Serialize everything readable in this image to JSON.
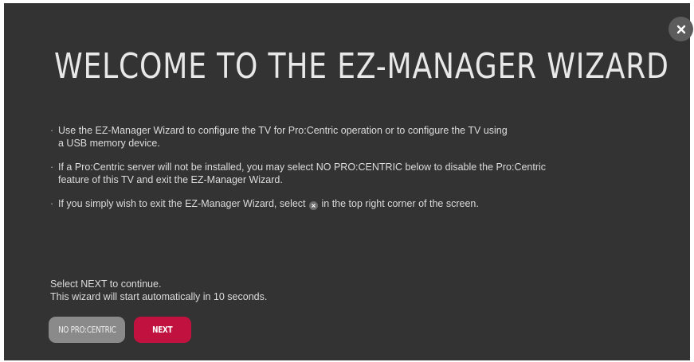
{
  "wizard": {
    "title": "WELCOME TO THE EZ-MANAGER WIZARD",
    "bullets": [
      {
        "line1": "Use the EZ-Manager Wizard to configure the TV for Pro:Centric operation or to configure the TV using",
        "line2": "a USB memory device."
      },
      {
        "line1": "If a Pro:Centric server will not be installed, you may select NO PRO:CENTRIC below to disable the Pro:Centric",
        "line2": "feature of this TV and exit the EZ-Manager Wizard."
      },
      {
        "before": "If you simply wish to exit the EZ-Manager Wizard, select",
        "after": "in the top right corner of the screen."
      }
    ],
    "bullet_marker": "·",
    "footer": {
      "line1": "Select NEXT to continue.",
      "line2": "This wizard will start automatically in 10 seconds."
    },
    "buttons": {
      "no_procentric": "NO PRO:CENTRIC",
      "next": "NEXT"
    }
  },
  "icons": {
    "close": "close-icon"
  },
  "colors": {
    "background": "#333333",
    "next_button": "#c0113f",
    "secondary_button": "#8a8a8a",
    "close_button": "#5c5c5c"
  }
}
